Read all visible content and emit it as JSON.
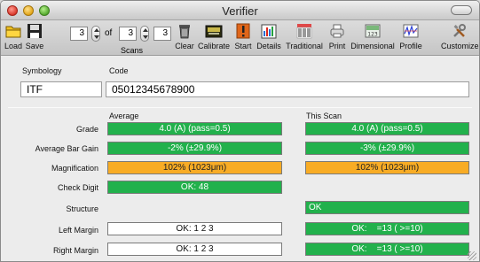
{
  "window": {
    "title": "Verifier"
  },
  "toolbar": {
    "load": "Load",
    "save": "Save",
    "scan_current": "3",
    "of_label": "of",
    "scan_total": "3",
    "scan_count": "3",
    "scans_label": "Scans",
    "clear": "Clear",
    "calibrate": "Calibrate",
    "start": "Start",
    "details": "Details",
    "traditional": "Traditional",
    "print": "Print",
    "dimensional": "Dimensional",
    "profile": "Profile",
    "customize": "Customize"
  },
  "symbology": {
    "label": "Symbology",
    "value": "ITF"
  },
  "code": {
    "label": "Code",
    "value": "05012345678900"
  },
  "columns": {
    "average": "Average",
    "this_scan": "This Scan"
  },
  "rows": [
    {
      "label": "Grade",
      "average": "4.0 (A) (pass=0.5)",
      "average_color": "#22b14c",
      "scan": "4.0 (A) (pass=0.5)",
      "scan_color": "#22b14c"
    },
    {
      "label": "Average Bar Gain",
      "average": "-2% (±29.9%)",
      "average_color": "#22b14c",
      "scan": "-3% (±29.9%)",
      "scan_color": "#22b14c"
    },
    {
      "label": "Magnification",
      "average": "102% (1023μm)",
      "average_color": "#f8ac25",
      "scan": "102% (1023μm)",
      "scan_color": "#f8ac25"
    },
    {
      "label": "Check Digit",
      "average": "OK: 48",
      "average_color": "#22b14c",
      "scan": "",
      "scan_color": ""
    },
    {
      "label": "Structure",
      "average": "",
      "average_color": "",
      "scan": "OK",
      "scan_color": "#22b14c"
    },
    {
      "label": "Left Margin",
      "average": "OK: 1 2 3",
      "average_color": "#ffffff",
      "scan": "OK:    =13 ( >=10)",
      "scan_color": "#22b14c"
    },
    {
      "label": "Right Margin",
      "average": "OK: 1 2 3",
      "average_color": "#ffffff",
      "scan": "OK:    =13 ( >=10)",
      "scan_color": "#22b14c"
    }
  ],
  "icons": {
    "load": "folder-icon",
    "save": "floppy-disk-icon",
    "clear": "trash-can-icon",
    "calibrate": "calibration-card-icon",
    "start": "exclamation-icon",
    "details": "details-chart-icon",
    "traditional": "barcode-icon",
    "print": "printer-icon",
    "dimensional": "dimensional-icon",
    "profile": "profile-graph-icon",
    "customize": "tools-icon"
  }
}
